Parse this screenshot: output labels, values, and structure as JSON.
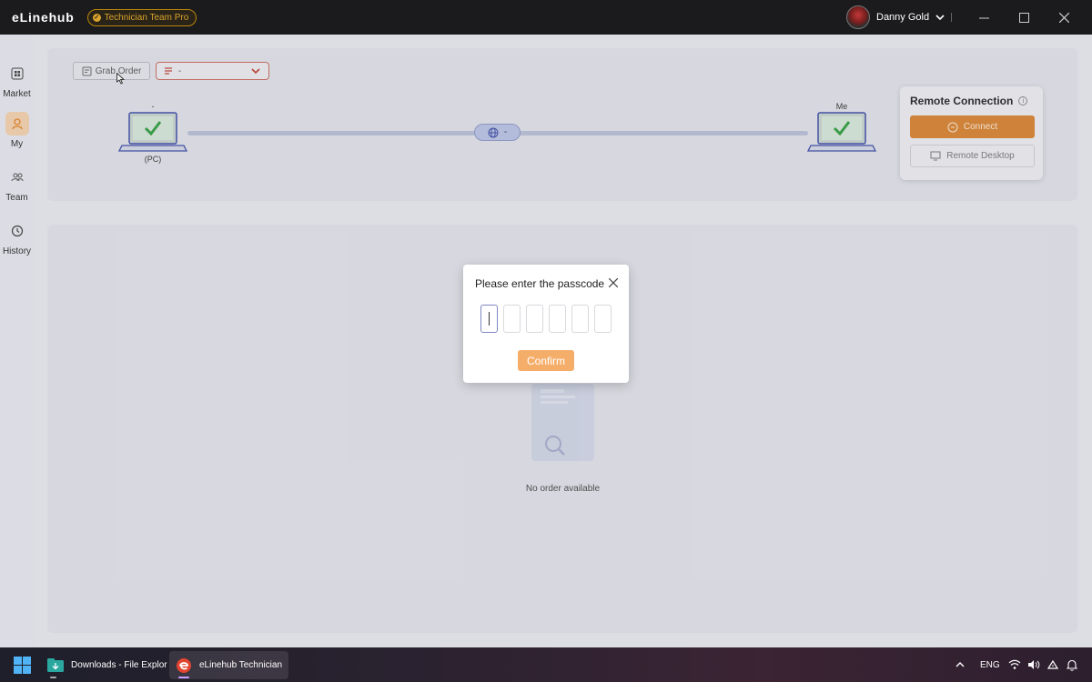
{
  "titlebar": {
    "brand": "eLinehub",
    "badge": "Technician Team Pro",
    "user_name": "Danny Gold",
    "sep": "|"
  },
  "sidebar": {
    "items": [
      {
        "label": "Market",
        "icon": "grid-icon"
      },
      {
        "label": "My",
        "icon": "person-icon"
      },
      {
        "label": "Team",
        "icon": "team-icon"
      },
      {
        "label": "History",
        "icon": "history-icon"
      }
    ],
    "active": "My"
  },
  "toolbar": {
    "grab_order": "Grab Order",
    "order_select_value": "-"
  },
  "connection": {
    "left_name": "-",
    "left_sub": "(PC)",
    "middle_value": "-",
    "right_name": "Me"
  },
  "remote": {
    "title": "Remote Connection",
    "connect": "Connect",
    "remote_desktop": "Remote Desktop"
  },
  "empty_state": {
    "text": "No order available"
  },
  "modal": {
    "title": "Please enter the passcode",
    "confirm": "Confirm",
    "digits": [
      "",
      "",
      "",
      "",
      "",
      ""
    ]
  },
  "taskbar": {
    "items": [
      {
        "label": "Downloads - File Explor"
      },
      {
        "label": "eLinehub Technician"
      }
    ],
    "lang": "ENG"
  },
  "colors": {
    "accent": "#d9822e",
    "confirm": "#f5ae6a",
    "check": "#2e9e3e",
    "select_border": "#c96a5a"
  }
}
